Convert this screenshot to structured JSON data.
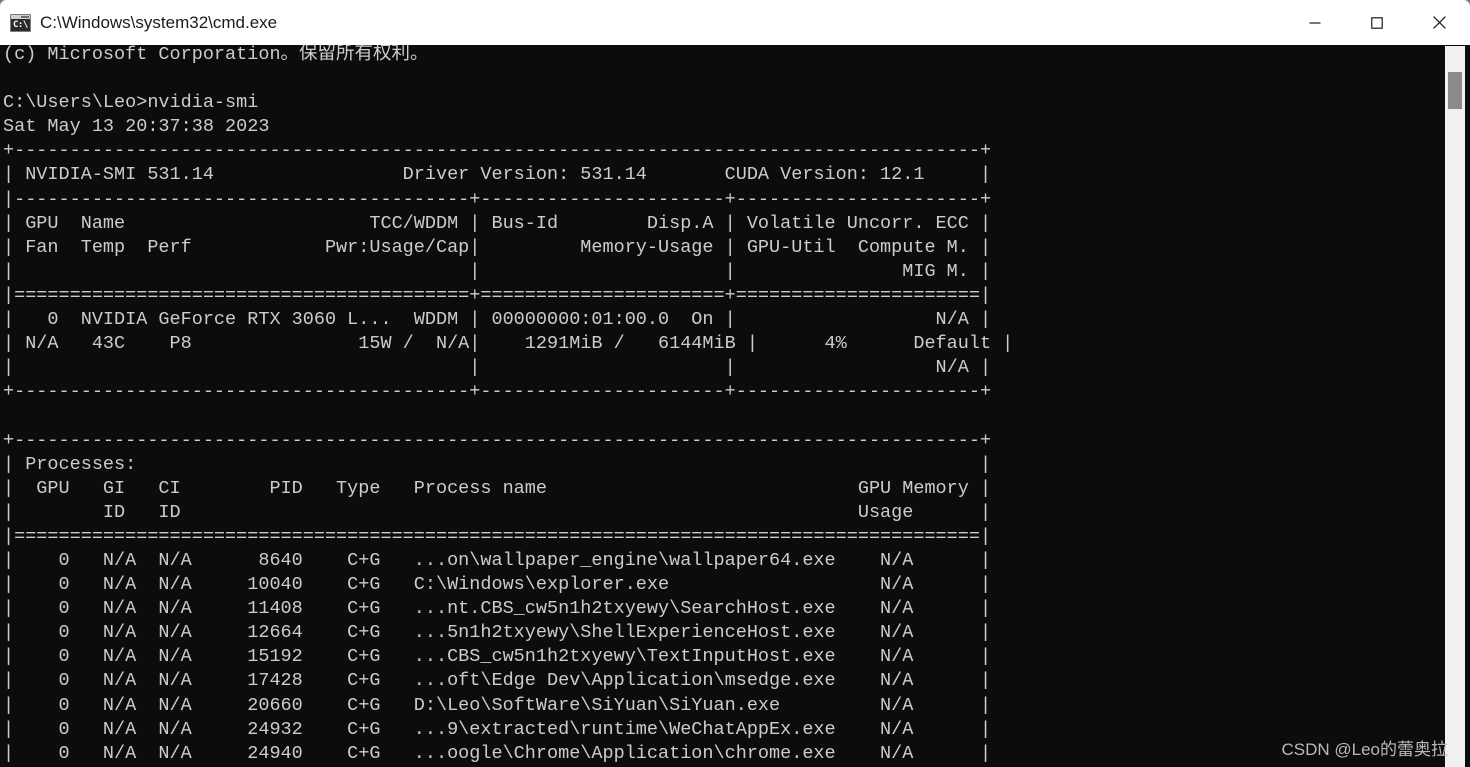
{
  "window": {
    "title": "C:\\Windows\\system32\\cmd.exe",
    "icon": "cmd-icon",
    "icon_glyph": "C:\\",
    "controls": {
      "minimize": "minimize",
      "maximize": "maximize",
      "close": "close"
    },
    "titlebar_bg": "#ffffff",
    "title_color": "#1b1b1b"
  },
  "terminal": {
    "background": "#0c0c0c",
    "foreground": "#cccccc",
    "scrollbar": {
      "track_color": "#f0f0f0",
      "thumb_color": "#8a8a8a"
    },
    "lines": [
      "(c) Microsoft Corporation。保留所有权利。",
      "",
      "C:\\Users\\Leo>nvidia-smi",
      "Sat May 13 20:37:38 2023",
      "+---------------------------------------------------------------------------------------+",
      "| NVIDIA-SMI 531.14                 Driver Version: 531.14       CUDA Version: 12.1     |",
      "|-----------------------------------------+----------------------+----------------------+",
      "| GPU  Name                      TCC/WDDM | Bus-Id        Disp.A | Volatile Uncorr. ECC |",
      "| Fan  Temp  Perf            Pwr:Usage/Cap|         Memory-Usage | GPU-Util  Compute M. |",
      "|                                         |                      |               MIG M. |",
      "|=========================================+======================+======================|",
      "|   0  NVIDIA GeForce RTX 3060 L...  WDDM | 00000000:01:00.0  On |                  N/A |",
      "| N/A   43C    P8               15W /  N/A|    1291MiB /   6144MiB |      4%      Default |",
      "|                                         |                      |                  N/A |",
      "+-----------------------------------------+----------------------+----------------------+",
      "",
      "+---------------------------------------------------------------------------------------+",
      "| Processes:                                                                            |",
      "|  GPU   GI   CI        PID   Type   Process name                            GPU Memory |",
      "|        ID   ID                                                             Usage      |",
      "|=======================================================================================|",
      "|    0   N/A  N/A      8640    C+G   ...on\\wallpaper_engine\\wallpaper64.exe    N/A      |",
      "|    0   N/A  N/A     10040    C+G   C:\\Windows\\explorer.exe                   N/A      |",
      "|    0   N/A  N/A     11408    C+G   ...nt.CBS_cw5n1h2txyewy\\SearchHost.exe    N/A      |",
      "|    0   N/A  N/A     12664    C+G   ...5n1h2txyewy\\ShellExperienceHost.exe    N/A      |",
      "|    0   N/A  N/A     15192    C+G   ...CBS_cw5n1h2txyewy\\TextInputHost.exe    N/A      |",
      "|    0   N/A  N/A     17428    C+G   ...oft\\Edge Dev\\Application\\msedge.exe    N/A      |",
      "|    0   N/A  N/A     20660    C+G   D:\\Leo\\SoftWare\\SiYuan\\SiYuan.exe         N/A      |",
      "|    0   N/A  N/A     24932    C+G   ...9\\extracted\\runtime\\WeChatAppEx.exe    N/A      |",
      "|    0   N/A  N/A     24940    C+G   ...oogle\\Chrome\\Application\\chrome.exe    N/A      |"
    ],
    "nvidia_smi": {
      "smi_version": "NVIDIA-SMI 531.14",
      "driver_version": "Driver Version: 531.14",
      "cuda_version": "CUDA Version: 12.1",
      "timestamp": "Sat May 13 20:37:38 2023",
      "command": "nvidia-smi",
      "prompt": "C:\\Users\\Leo>",
      "copyright": "(c) Microsoft Corporation。保留所有权利。",
      "gpu_table": {
        "headers_row1": [
          "GPU",
          "Name",
          "TCC/WDDM",
          "Bus-Id",
          "Disp.A",
          "Volatile Uncorr. ECC"
        ],
        "headers_row2": [
          "Fan",
          "Temp",
          "Perf",
          "Pwr:Usage/Cap",
          "Memory-Usage",
          "GPU-Util",
          "Compute M."
        ],
        "headers_row3": [
          "MIG M."
        ],
        "rows": [
          {
            "gpu": "0",
            "name": "NVIDIA GeForce RTX 3060 L...",
            "tcc_wddm": "WDDM",
            "bus_id": "00000000:01:00.0",
            "disp_a": "On",
            "ecc": "N/A",
            "fan": "N/A",
            "temp": "43C",
            "perf": "P8",
            "pwr": "15W /  N/A",
            "memory": "1291MiB /   6144MiB",
            "gpu_util": "4%",
            "compute_m": "Default",
            "mig_m": "N/A"
          }
        ]
      },
      "processes_table": {
        "title": "Processes:",
        "headers": [
          "GPU",
          "GI\nID",
          "CI\nID",
          "PID",
          "Type",
          "Process name",
          "GPU Memory\nUsage"
        ],
        "rows": [
          {
            "gpu": "0",
            "gi_id": "N/A",
            "ci_id": "N/A",
            "pid": "8640",
            "type": "C+G",
            "name": "...on\\wallpaper_engine\\wallpaper64.exe",
            "memory": "N/A"
          },
          {
            "gpu": "0",
            "gi_id": "N/A",
            "ci_id": "N/A",
            "pid": "10040",
            "type": "C+G",
            "name": "C:\\Windows\\explorer.exe",
            "memory": "N/A"
          },
          {
            "gpu": "0",
            "gi_id": "N/A",
            "ci_id": "N/A",
            "pid": "11408",
            "type": "C+G",
            "name": "...nt.CBS_cw5n1h2txyewy\\SearchHost.exe",
            "memory": "N/A"
          },
          {
            "gpu": "0",
            "gi_id": "N/A",
            "ci_id": "N/A",
            "pid": "12664",
            "type": "C+G",
            "name": "...5n1h2txyewy\\ShellExperienceHost.exe",
            "memory": "N/A"
          },
          {
            "gpu": "0",
            "gi_id": "N/A",
            "ci_id": "N/A",
            "pid": "15192",
            "type": "C+G",
            "name": "...CBS_cw5n1h2txyewy\\TextInputHost.exe",
            "memory": "N/A"
          },
          {
            "gpu": "0",
            "gi_id": "N/A",
            "ci_id": "N/A",
            "pid": "17428",
            "type": "C+G",
            "name": "...oft\\Edge Dev\\Application\\msedge.exe",
            "memory": "N/A"
          },
          {
            "gpu": "0",
            "gi_id": "N/A",
            "ci_id": "N/A",
            "pid": "20660",
            "type": "C+G",
            "name": "D:\\Leo\\SoftWare\\SiYuan\\SiYuan.exe",
            "memory": "N/A"
          },
          {
            "gpu": "0",
            "gi_id": "N/A",
            "ci_id": "N/A",
            "pid": "24932",
            "type": "C+G",
            "name": "...9\\extracted\\runtime\\WeChatAppEx.exe",
            "memory": "N/A"
          },
          {
            "gpu": "0",
            "gi_id": "N/A",
            "ci_id": "N/A",
            "pid": "24940",
            "type": "C+G",
            "name": "...oogle\\Chrome\\Application\\chrome.exe",
            "memory": "N/A"
          }
        ]
      }
    }
  },
  "watermark": {
    "text": "CSDN @Leo的蕾奥拉",
    "color": "#b9b9b9"
  }
}
